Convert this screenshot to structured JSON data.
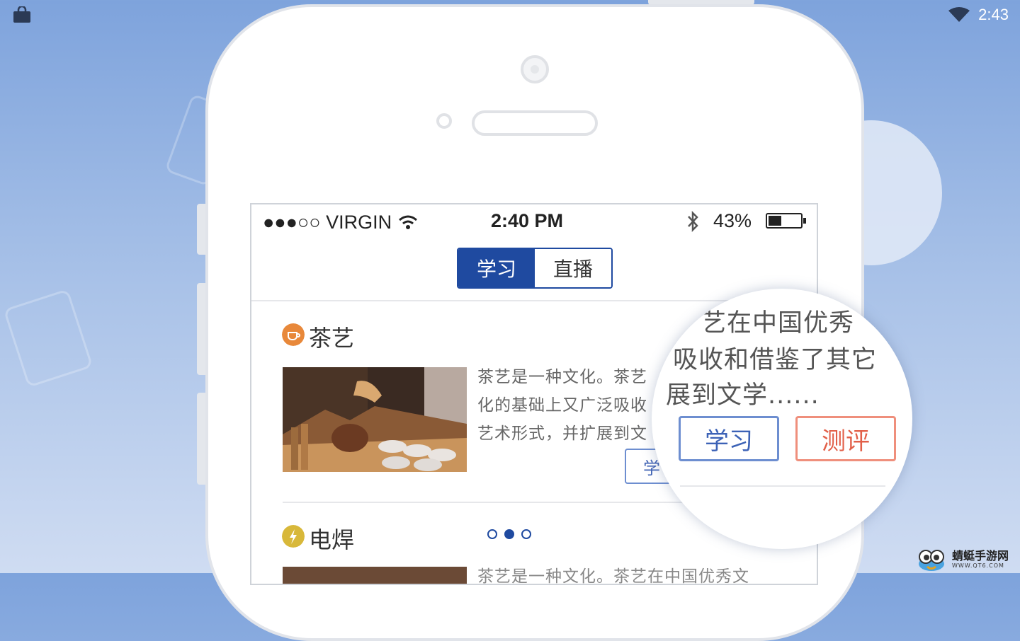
{
  "android_status": {
    "time": "2:43",
    "icons": [
      "shopping-bag-icon",
      "wifi-icon"
    ]
  },
  "ios_status": {
    "signal": "●●●○○",
    "carrier": "VIRGIN",
    "time": "2:40 PM",
    "battery": "43%"
  },
  "tabs": [
    {
      "label": "学习",
      "active": true
    },
    {
      "label": "直播",
      "active": false
    }
  ],
  "sections": [
    {
      "title": "茶艺",
      "icon": "teacup-icon",
      "icon_color": "#e8883a",
      "description": [
        "茶艺是一种文化。茶艺",
        "化的基础上又广泛吸收",
        "艺术形式，并扩展到文"
      ],
      "study_button": "学"
    },
    {
      "title": "电焊",
      "icon": "lightning-icon",
      "icon_color": "#d8b83a",
      "description": [
        "茶艺是一种文化。茶艺在中国优秀文"
      ]
    }
  ],
  "magnifier": {
    "lines": [
      "艺在中国优秀",
      "吸收和借鉴了其它",
      "展到文学......"
    ],
    "study_button": "学习",
    "evaluate_button": "测评"
  },
  "pagination": {
    "total": 3,
    "active": 2
  },
  "watermark": {
    "title": "蜻蜓手游网",
    "url": "WWW.QT6.COM"
  }
}
